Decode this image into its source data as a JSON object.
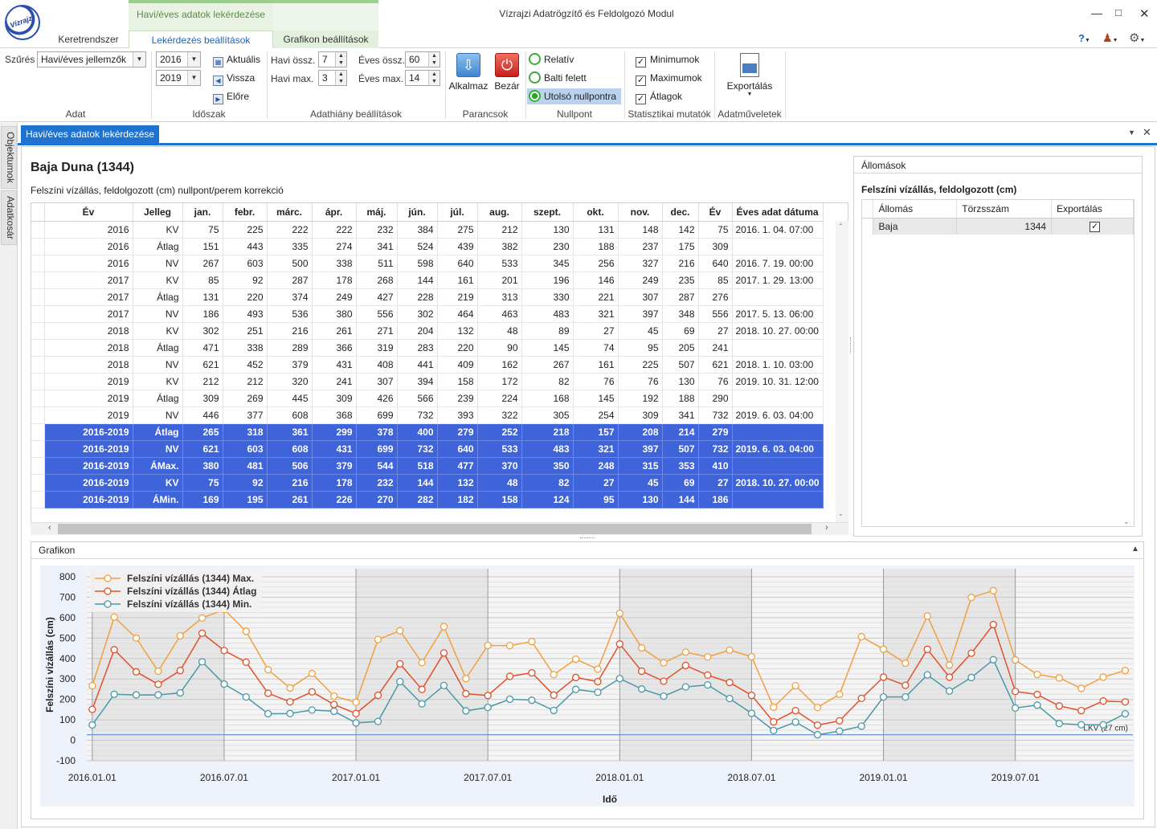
{
  "window": {
    "title": "Vízrajzi Adatrögzítő és Feldolgozó Modul",
    "logo_text": "Vízrajz"
  },
  "ribbon_context": {
    "title": "Havi/éves adatok lekérdezése"
  },
  "tabs": [
    {
      "label": "Keretrendszer"
    },
    {
      "label": "Lekérdezés beállítások"
    },
    {
      "label": "Grafikon beállítások"
    }
  ],
  "icons": {
    "help": "question-icon",
    "user": "user-icon",
    "settings": "gear-icon"
  },
  "ribbon": {
    "adat": {
      "label": "Adat",
      "filter_label": "Szűrés",
      "filter_value": "Havi/éves jellemzők"
    },
    "idoszak": {
      "label": "Időszak",
      "year_from": "2016",
      "year_to": "2019",
      "current": "Aktuális",
      "back": "Vissza",
      "forward": "Előre"
    },
    "adathiany": {
      "label": "Adathiány beállítások",
      "monthly_sum_label": "Havi össz.",
      "monthly_sum": "7",
      "monthly_max_label": "Havi max.",
      "monthly_max": "3",
      "yearly_sum_label": "Éves össz.",
      "yearly_sum": "60",
      "yearly_max_label": "Éves max.",
      "yearly_max": "14"
    },
    "parancsok": {
      "label": "Parancsok",
      "apply": "Alkalmaz",
      "close": "Bezár"
    },
    "nullpont": {
      "label": "Nullpont",
      "relative": "Relatív",
      "baltic": "Balti felett",
      "last_zero": "Utolsó nullpontra",
      "selected": "Utolsó nullpontra"
    },
    "stat": {
      "label": "Statisztikai mutatók",
      "minimums": "Minimumok",
      "maximums": "Maximumok",
      "averages": "Átlagok",
      "min_checked": true,
      "max_checked": true,
      "avg_checked": true
    },
    "export": {
      "label": "Adatműveletek",
      "button": "Exportálás"
    }
  },
  "sidebar": {
    "tabs": [
      "Objektumok",
      "Adatkosár"
    ]
  },
  "document": {
    "tab": "Havi/éves adatok lekérdezése"
  },
  "station": {
    "title": "Baja Duna (1344)",
    "subtitle": "Felszíni vízállás, feldolgozott (cm) nullpont/perem korrekció"
  },
  "table": {
    "columns": [
      "Év",
      "Jelleg",
      "jan.",
      "febr.",
      "márc.",
      "ápr.",
      "máj.",
      "jún.",
      "júl.",
      "aug.",
      "szept.",
      "okt.",
      "nov.",
      "dec.",
      "Év",
      "Éves adat dátuma"
    ],
    "rows": [
      [
        "2016",
        "KV",
        "75",
        "225",
        "222",
        "222",
        "232",
        "384",
        "275",
        "212",
        "130",
        "131",
        "148",
        "142",
        "75",
        "2016. 1. 04. 07:00"
      ],
      [
        "2016",
        "Átlag",
        "151",
        "443",
        "335",
        "274",
        "341",
        "524",
        "439",
        "382",
        "230",
        "188",
        "237",
        "175",
        "309",
        ""
      ],
      [
        "2016",
        "NV",
        "267",
        "603",
        "500",
        "338",
        "511",
        "598",
        "640",
        "533",
        "345",
        "256",
        "327",
        "216",
        "640",
        "2016. 7. 19. 00:00"
      ],
      [
        "2017",
        "KV",
        "85",
        "92",
        "287",
        "178",
        "268",
        "144",
        "161",
        "201",
        "196",
        "146",
        "249",
        "235",
        "85",
        "2017. 1. 29. 13:00"
      ],
      [
        "2017",
        "Átlag",
        "131",
        "220",
        "374",
        "249",
        "427",
        "228",
        "219",
        "313",
        "330",
        "221",
        "307",
        "287",
        "276",
        ""
      ],
      [
        "2017",
        "NV",
        "186",
        "493",
        "536",
        "380",
        "556",
        "302",
        "464",
        "463",
        "483",
        "321",
        "397",
        "348",
        "556",
        "2017. 5. 13. 06:00"
      ],
      [
        "2018",
        "KV",
        "302",
        "251",
        "216",
        "261",
        "271",
        "204",
        "132",
        "48",
        "89",
        "27",
        "45",
        "69",
        "27",
        "2018. 10. 27. 00:00"
      ],
      [
        "2018",
        "Átlag",
        "471",
        "338",
        "289",
        "366",
        "319",
        "283",
        "220",
        "90",
        "145",
        "74",
        "95",
        "205",
        "241",
        ""
      ],
      [
        "2018",
        "NV",
        "621",
        "452",
        "379",
        "431",
        "408",
        "441",
        "409",
        "162",
        "267",
        "161",
        "225",
        "507",
        "621",
        "2018. 1. 10. 03:00"
      ],
      [
        "2019",
        "KV",
        "212",
        "212",
        "320",
        "241",
        "307",
        "394",
        "158",
        "172",
        "82",
        "76",
        "76",
        "130",
        "76",
        "2019. 10. 31. 12:00"
      ],
      [
        "2019",
        "Átlag",
        "309",
        "269",
        "445",
        "309",
        "426",
        "566",
        "239",
        "224",
        "168",
        "145",
        "192",
        "188",
        "290",
        ""
      ],
      [
        "2019",
        "NV",
        "446",
        "377",
        "608",
        "368",
        "699",
        "732",
        "393",
        "322",
        "305",
        "254",
        "309",
        "341",
        "732",
        "2019. 6. 03. 04:00"
      ]
    ],
    "summary_rows": [
      [
        "2016-2019",
        "Átlag",
        "265",
        "318",
        "361",
        "299",
        "378",
        "400",
        "279",
        "252",
        "218",
        "157",
        "208",
        "214",
        "279",
        ""
      ],
      [
        "2016-2019",
        "NV",
        "621",
        "603",
        "608",
        "431",
        "699",
        "732",
        "640",
        "533",
        "483",
        "321",
        "397",
        "507",
        "732",
        "2019. 6. 03. 04:00"
      ],
      [
        "2016-2019",
        "ÁMax.",
        "380",
        "481",
        "506",
        "379",
        "544",
        "518",
        "477",
        "370",
        "350",
        "248",
        "315",
        "353",
        "410",
        ""
      ],
      [
        "2016-2019",
        "KV",
        "75",
        "92",
        "216",
        "178",
        "232",
        "144",
        "132",
        "48",
        "82",
        "27",
        "45",
        "69",
        "27",
        "2018. 10. 27. 00:00"
      ],
      [
        "2016-2019",
        "ÁMin.",
        "169",
        "195",
        "261",
        "226",
        "270",
        "282",
        "182",
        "158",
        "124",
        "95",
        "130",
        "144",
        "186",
        ""
      ]
    ]
  },
  "stations_panel": {
    "title": "Állomások",
    "subtitle": "Felszíni vízállás, feldolgozott (cm)",
    "columns": [
      "Állomás",
      "Törzsszám",
      "Exportálás"
    ],
    "rows": [
      {
        "name": "Baja",
        "id": "1344",
        "export": true
      }
    ]
  },
  "grafikon": {
    "title": "Grafikon"
  },
  "chart_data": {
    "type": "line",
    "xlabel": "Idő",
    "ylabel": "Felszíni vízállás (cm)",
    "ylim": [
      -100,
      800
    ],
    "yticks": [
      "800",
      "700",
      "600",
      "500",
      "400",
      "300",
      "200",
      "100",
      "0",
      "-100"
    ],
    "xticks": [
      "2016.01.01",
      "2016.07.01",
      "2017.01.01",
      "2017.07.01",
      "2018.01.01",
      "2018.07.01",
      "2019.01.01",
      "2019.07.01"
    ],
    "x": [
      "2016-01",
      "2016-02",
      "2016-03",
      "2016-04",
      "2016-05",
      "2016-06",
      "2016-07",
      "2016-08",
      "2016-09",
      "2016-10",
      "2016-11",
      "2016-12",
      "2017-01",
      "2017-02",
      "2017-03",
      "2017-04",
      "2017-05",
      "2017-06",
      "2017-07",
      "2017-08",
      "2017-09",
      "2017-10",
      "2017-11",
      "2017-12",
      "2018-01",
      "2018-02",
      "2018-03",
      "2018-04",
      "2018-05",
      "2018-06",
      "2018-07",
      "2018-08",
      "2018-09",
      "2018-10",
      "2018-11",
      "2018-12",
      "2019-01",
      "2019-02",
      "2019-03",
      "2019-04",
      "2019-05",
      "2019-06",
      "2019-07",
      "2019-08",
      "2019-09",
      "2019-10",
      "2019-11",
      "2019-12"
    ],
    "legend_position": "top-left",
    "grid": true,
    "series": [
      {
        "name": "Felszíni vízállás (1344) Max.",
        "color": "#f0a040",
        "values": [
          267,
          603,
          500,
          338,
          511,
          598,
          640,
          533,
          345,
          256,
          327,
          216,
          186,
          493,
          536,
          380,
          556,
          302,
          464,
          463,
          483,
          321,
          397,
          348,
          621,
          452,
          379,
          431,
          408,
          441,
          409,
          162,
          267,
          161,
          225,
          507,
          446,
          377,
          608,
          368,
          699,
          732,
          393,
          322,
          305,
          254,
          309,
          341
        ]
      },
      {
        "name": "Felszíni vízállás (1344) Átlag",
        "color": "#e0502a",
        "values": [
          151,
          443,
          335,
          274,
          341,
          524,
          439,
          382,
          230,
          188,
          237,
          175,
          131,
          220,
          374,
          249,
          427,
          228,
          219,
          313,
          330,
          221,
          307,
          287,
          471,
          338,
          289,
          366,
          319,
          283,
          220,
          90,
          145,
          74,
          95,
          205,
          309,
          269,
          445,
          309,
          426,
          566,
          239,
          224,
          168,
          145,
          192,
          188
        ]
      },
      {
        "name": "Felszíni vízállás (1344) Min.",
        "color": "#4a98a8",
        "values": [
          75,
          225,
          222,
          222,
          232,
          384,
          275,
          212,
          130,
          131,
          148,
          142,
          85,
          92,
          287,
          178,
          268,
          144,
          161,
          201,
          196,
          146,
          249,
          235,
          302,
          251,
          216,
          261,
          271,
          204,
          132,
          48,
          89,
          27,
          45,
          69,
          212,
          212,
          320,
          241,
          307,
          394,
          158,
          172,
          82,
          76,
          76,
          130
        ]
      }
    ],
    "reference_line": {
      "label": "LKV (27 cm)",
      "value": 27,
      "color": "#5a88d8"
    }
  }
}
